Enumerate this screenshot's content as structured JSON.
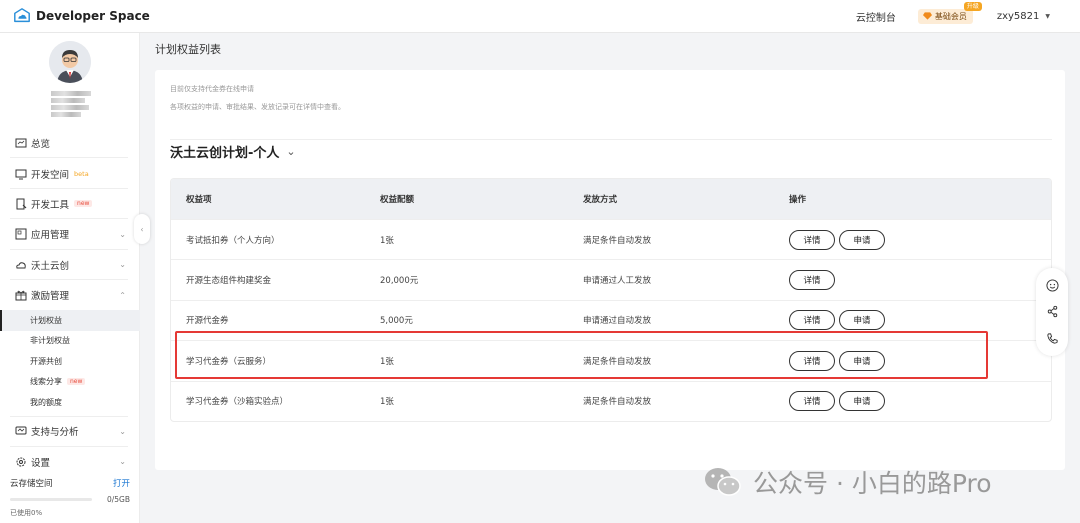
{
  "header": {
    "brand": "Developer Space",
    "console_link": "云控制台",
    "member_label": "基础会员",
    "member_tag": "升级",
    "username": "zxy5821"
  },
  "sidebar": {
    "items": [
      {
        "label": "总览",
        "icon": "overview-icon"
      },
      {
        "label": "开发空间",
        "icon": "monitor-icon",
        "tag": "beta"
      },
      {
        "label": "开发工具",
        "icon": "tools-icon",
        "tag": "new"
      },
      {
        "label": "应用管理",
        "icon": "app-icon"
      },
      {
        "label": "沃土云创",
        "icon": "cloud-icon"
      },
      {
        "label": "激励管理",
        "icon": "gift-icon"
      }
    ],
    "sub_items": [
      {
        "label": "计划权益"
      },
      {
        "label": "非计划权益"
      },
      {
        "label": "开源共创"
      },
      {
        "label": "线索分享",
        "tag": "new"
      },
      {
        "label": "我的额度"
      }
    ],
    "bottom_items": [
      {
        "label": "支持与分析",
        "icon": "support-icon"
      },
      {
        "label": "设置",
        "icon": "settings-icon"
      }
    ],
    "storage": {
      "label": "云存储空间",
      "action": "打开",
      "amount": "0/5GB",
      "used": "已使用0%"
    }
  },
  "main": {
    "page_title": "计划权益列表",
    "tips": [
      "目前仅支持代金券在线申请",
      "各项权益的申请、审批结果、发放记录可在详情中查看。"
    ],
    "plan_title": "沃土云创计划-个人",
    "table": {
      "headers": [
        "权益项",
        "权益配额",
        "发放方式",
        "操作"
      ],
      "rows": [
        {
          "name": "考试抵扣券（个人方向）",
          "quota": "1张",
          "method": "满足条件自动发放",
          "detail": "详情",
          "apply": "申请"
        },
        {
          "name": "开源生态组件构建奖金",
          "quota": "20,000元",
          "method": "申请通过人工发放",
          "detail": "详情",
          "apply": ""
        },
        {
          "name": "开源代金券",
          "quota": "5,000元",
          "method": "申请通过自动发放",
          "detail": "详情",
          "apply": "申请"
        },
        {
          "name": "学习代金券（云服务）",
          "quota": "1张",
          "method": "满足条件自动发放",
          "detail": "详情",
          "apply": "申请"
        },
        {
          "name": "学习代金券（沙箱实验点）",
          "quota": "1张",
          "method": "满足条件自动发放",
          "detail": "详情",
          "apply": "申请"
        }
      ]
    }
  },
  "watermark": "公众号 · 小白的路Pro",
  "colors": {
    "highlight": "#e53935",
    "link": "#1976d2",
    "member_bg": "#fdecd6",
    "beta": "#f5a623",
    "new": "#e74c3c"
  }
}
